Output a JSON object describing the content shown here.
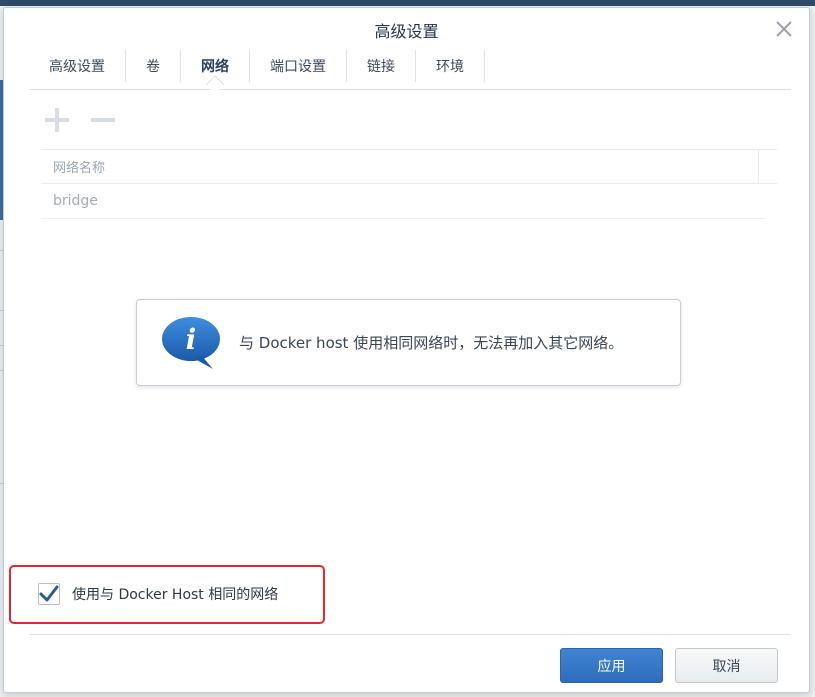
{
  "dialog": {
    "title": "高级设置",
    "close_icon": "close-icon"
  },
  "tabs": [
    {
      "label": "高级设置",
      "active": false
    },
    {
      "label": "卷",
      "active": false
    },
    {
      "label": "网络",
      "active": true
    },
    {
      "label": "端口设置",
      "active": false
    },
    {
      "label": "链接",
      "active": false
    },
    {
      "label": "环境",
      "active": false
    }
  ],
  "toolbar": {
    "add_icon": "plus-icon",
    "remove_icon": "minus-icon"
  },
  "network_grid": {
    "header": "网络名称",
    "rows": [
      "bridge"
    ]
  },
  "info": {
    "icon": "info-bubble-icon",
    "message": "与 Docker host 使用相同网络时，无法再加入其它网络。"
  },
  "host_network": {
    "label": "使用与 Docker Host 相同的网络",
    "checked": true
  },
  "footer": {
    "apply_label": "应用",
    "cancel_label": "取消"
  },
  "colors": {
    "accent": "#2f6cbb",
    "highlight": "#e8272c",
    "title": "#24364d"
  }
}
